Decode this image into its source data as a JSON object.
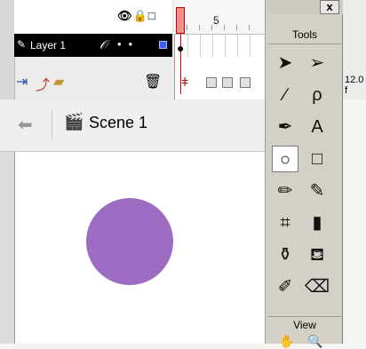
{
  "timeline": {
    "layer_name": "Layer 1",
    "frame_number": "5",
    "frame_rate": "12.0 f"
  },
  "edit_bar": {
    "scene_label": "Scene 1"
  },
  "tools_panel": {
    "title": "Tools",
    "close_label": "x",
    "view_label": "View",
    "tools": [
      {
        "name": "arrow-tool",
        "glyph": "➤"
      },
      {
        "name": "subselect-tool",
        "glyph": "➢"
      },
      {
        "name": "line-tool",
        "glyph": "∕"
      },
      {
        "name": "lasso-tool",
        "glyph": "ρ"
      },
      {
        "name": "pen-tool",
        "glyph": "✒"
      },
      {
        "name": "text-tool",
        "glyph": "A"
      },
      {
        "name": "oval-tool",
        "glyph": "○"
      },
      {
        "name": "rectangle-tool",
        "glyph": "□"
      },
      {
        "name": "pencil-tool",
        "glyph": "✏"
      },
      {
        "name": "brush-tool",
        "glyph": "✎"
      },
      {
        "name": "free-transform-tool",
        "glyph": "⌗"
      },
      {
        "name": "fill-transform-tool",
        "glyph": "▮"
      },
      {
        "name": "ink-bottle-tool",
        "glyph": "⚱"
      },
      {
        "name": "paint-bucket-tool",
        "glyph": "⛾"
      },
      {
        "name": "eyedropper-tool",
        "glyph": "✐"
      },
      {
        "name": "eraser-tool",
        "glyph": "⌫"
      }
    ],
    "selected_tool": "oval-tool"
  },
  "stage": {
    "shape": "circle",
    "shape_color": "#9b6cc2",
    "background_color": "#ffffff"
  }
}
